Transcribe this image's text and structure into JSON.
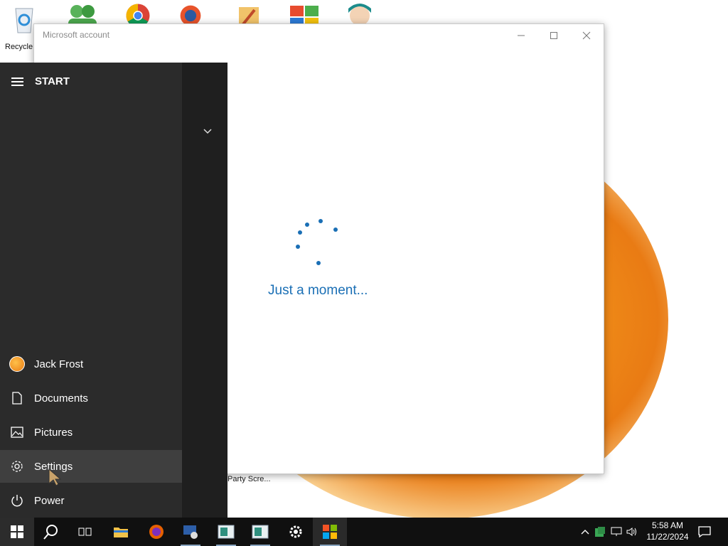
{
  "desktop": {
    "icons": [
      {
        "name": "recycle-bin-icon",
        "label": "Recycle"
      },
      {
        "name": "people-icon",
        "label": ""
      },
      {
        "name": "chrome-icon",
        "label": ""
      },
      {
        "name": "app-icon",
        "label": ""
      },
      {
        "name": "setup-icon",
        "label": ""
      },
      {
        "name": "windows-shield-icon",
        "label": ""
      },
      {
        "name": "character-icon",
        "label": ""
      }
    ],
    "partial_label": "Party Scre..."
  },
  "window": {
    "title": "Microsoft account",
    "status_text": "Just a moment..."
  },
  "start_menu": {
    "header": "START",
    "user": "Jack Frost",
    "items": [
      {
        "label": "Documents",
        "icon": "document-icon"
      },
      {
        "label": "Pictures",
        "icon": "pictures-icon"
      },
      {
        "label": "Settings",
        "icon": "gear-icon"
      },
      {
        "label": "Power",
        "icon": "power-icon"
      }
    ]
  },
  "taskbar": {
    "time": "5:58 AM",
    "date": "11/22/2024"
  },
  "colors": {
    "accent": "#1a6fb5",
    "start_bg": "#2b2b2b",
    "taskbar_bg": "#101010",
    "wallpaper_orange": "#f08c18"
  }
}
